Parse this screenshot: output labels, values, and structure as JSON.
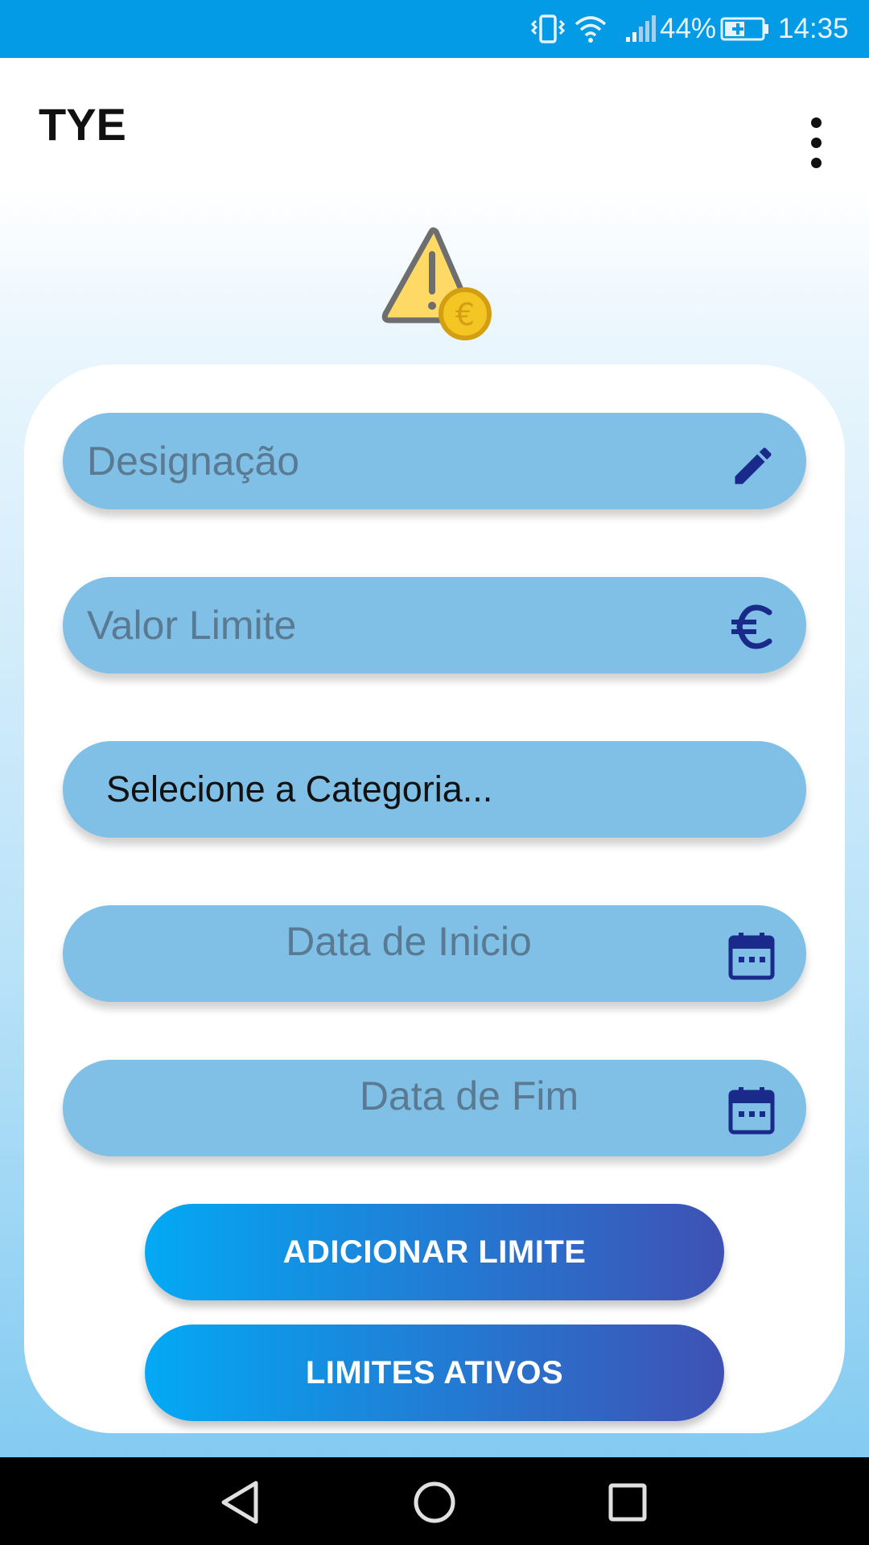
{
  "status_bar": {
    "battery": "44%",
    "time": "14:35",
    "icons": [
      "vibrate-icon",
      "wifi-icon",
      "signal-icon",
      "battery-charging-icon"
    ]
  },
  "app_bar": {
    "title": "TYE",
    "menu_icon": "more-vert-icon"
  },
  "hero_icon": "warning-euro-icon",
  "form": {
    "designacao": {
      "placeholder": "Designação",
      "value": "",
      "icon": "edit-pencil-icon"
    },
    "valor_limite": {
      "placeholder": "Valor Limite",
      "value": "",
      "icon": "euro-icon"
    },
    "categoria": {
      "selected": "Selecione a Categoria..."
    },
    "data_inicio": {
      "placeholder": "Data de Inicio",
      "icon": "calendar-icon"
    },
    "data_fim": {
      "placeholder": "Data de Fim",
      "icon": "calendar-icon"
    }
  },
  "buttons": {
    "adicionar": "ADICIONAR LIMITE",
    "ativos": "LIMITES ATIVOS"
  },
  "nav_bar": {
    "icons": [
      "back-icon",
      "home-icon",
      "recents-icon"
    ]
  },
  "colors": {
    "status_bar": "#039be5",
    "field_bg": "#80bfe6",
    "icon_navy": "#1a2a8a",
    "button_gradient_start": "#03a9f4",
    "button_gradient_end": "#3f51b5"
  }
}
